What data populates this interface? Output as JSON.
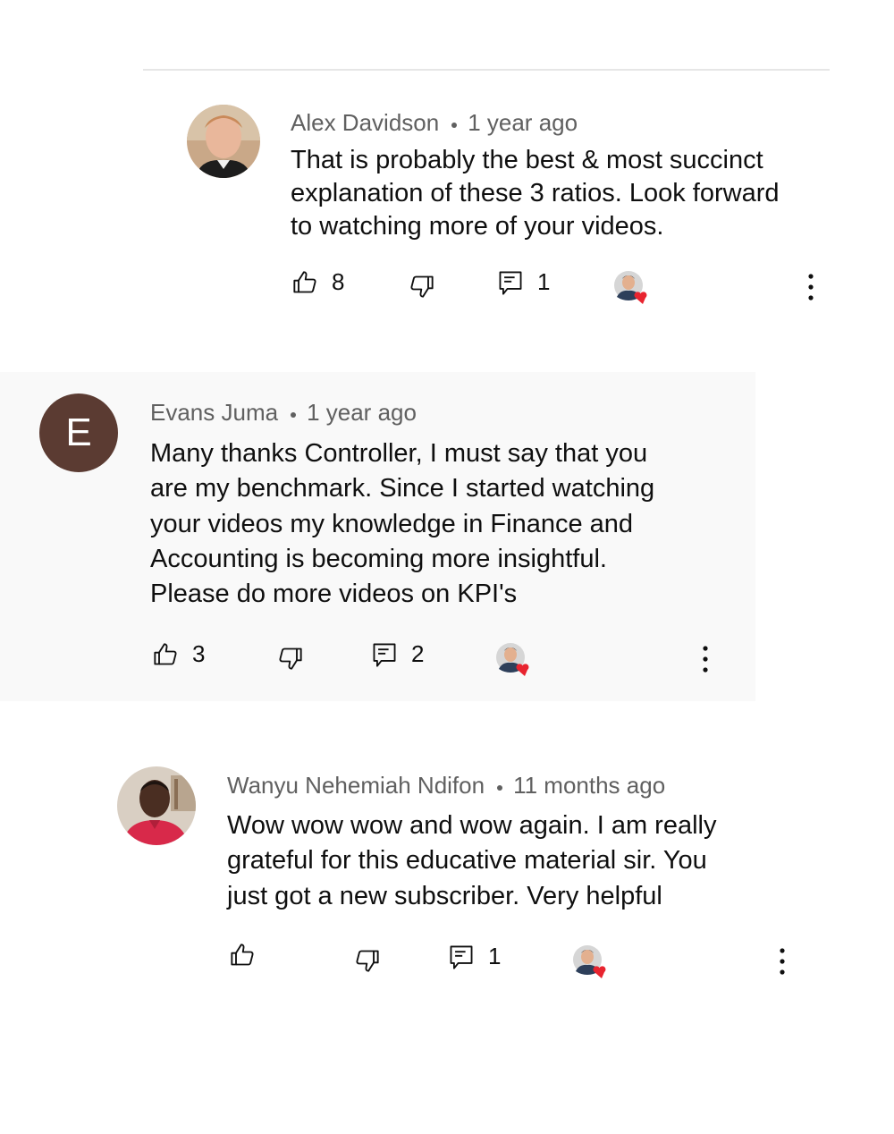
{
  "comments": [
    {
      "author": "Alex Davidson",
      "time": "1 year ago",
      "text": "That is probably the best & most succinct\nexplanation of these 3 ratios.  Look forward\nto watching more of your videos.",
      "likes": "8",
      "replies": "1"
    },
    {
      "avatar_letter": "E",
      "author": "Evans Juma",
      "time": "1 year ago",
      "text": "Many thanks Controller, I must say that you\nare my benchmark. Since I started watching\nyour videos my knowledge in Finance and\nAccounting is becoming more insightful.\nPlease do more videos on KPI's",
      "likes": "3",
      "replies": "2"
    },
    {
      "author": "Wanyu Nehemiah Ndifon",
      "time": "11 months ago",
      "text": "Wow wow wow and wow again. I am really\ngrateful for this educative material sir. You\njust got a new subscriber. Very helpful",
      "likes": "",
      "replies": "1"
    }
  ],
  "icons": {
    "like": "thumbs-up-icon",
    "dislike": "thumbs-down-icon",
    "reply": "reply-icon",
    "creator_heart": "creator-heart-icon",
    "more": "more-vertical-icon"
  },
  "colors": {
    "heart": "#e8242f",
    "meta_text": "#606060",
    "highlight_bg": "#f9f9f9",
    "letter_avatar_bg": "#5b3b32"
  }
}
